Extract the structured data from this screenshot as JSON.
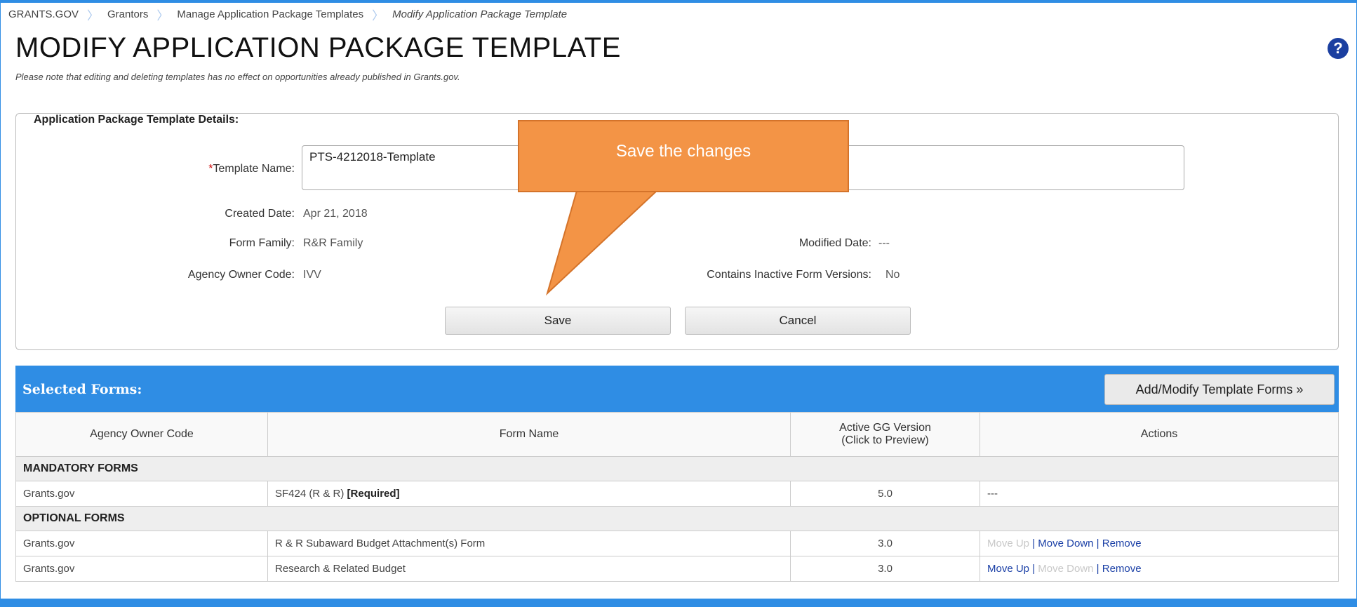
{
  "breadcrumb": [
    "GRANTS.GOV",
    "Grantors",
    "Manage Application Package Templates",
    "Modify Application Package Template"
  ],
  "page": {
    "title": "MODIFY APPLICATION PACKAGE TEMPLATE",
    "note": "Please note that editing and deleting templates has no effect on opportunities already published in Grants.gov.",
    "help_icon": "?"
  },
  "details": {
    "legend": "Application Package Template Details:",
    "required_mark": "*",
    "template_name_label": "Template Name:",
    "template_name_value": "PTS-4212018-Template",
    "created_date_label": "Created Date:",
    "created_date_value": "Apr 21, 2018",
    "form_family_label": "Form Family:",
    "form_family_value": "R&R Family",
    "agency_owner_label": "Agency Owner Code:",
    "agency_owner_value": "IVV",
    "modified_date_label": "Modified Date:",
    "modified_date_value": "---",
    "inactive_label": "Contains Inactive Form Versions:",
    "inactive_value": "No",
    "save_label": "Save",
    "cancel_label": "Cancel"
  },
  "callout": {
    "text": "Save the changes"
  },
  "selected_forms": {
    "title": "Selected Forms:",
    "add_modify_label": "Add/Modify Template Forms »",
    "columns": [
      "Agency Owner Code",
      "Form Name",
      "Active GG Version",
      "(Click to Preview)",
      "Actions"
    ],
    "mandatory_group": "MANDATORY FORMS",
    "optional_group": "OPTIONAL FORMS",
    "mandatory_rows": [
      {
        "agency": "Grants.gov",
        "form": "SF424 (R & R)",
        "form_tag": "[Required]",
        "version": "5.0",
        "actions": "---"
      }
    ],
    "optional_rows": [
      {
        "agency": "Grants.gov",
        "form": "R & R Subaward Budget Attachment(s) Form",
        "version": "3.0",
        "move_up": "Move Up",
        "move_down": "Move Down",
        "remove": "Remove",
        "sep": "|"
      },
      {
        "agency": "Grants.gov",
        "form": "Research & Related Budget",
        "version": "3.0",
        "move_up": "Move Up",
        "move_down": "Move Down",
        "remove": "Remove",
        "sep": "|"
      }
    ]
  },
  "colors": {
    "accent": "#2f8de4",
    "callout": "#f39446",
    "link": "#1a3fa6",
    "required": "#cc0000"
  }
}
